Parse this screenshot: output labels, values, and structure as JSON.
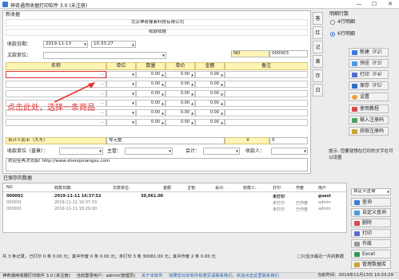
{
  "window": {
    "title": "神奇通用收据打印软件 3.0 (未注册)",
    "minimize": "—",
    "maximize": "☐",
    "close": "✕"
  },
  "form": {
    "section_title": "新收据",
    "company": "北京神奇像素科技有限公司",
    "receipt_title": "收款收据",
    "date_label": "收款日期：",
    "date_value": "2019-11-13",
    "time_value": "10:33:27",
    "unit_label": "文款单位：",
    "no_label": "NO",
    "no_value": "000003",
    "columns": [
      "名称",
      "单位",
      "数量",
      "单价",
      "金额",
      "备注"
    ],
    "rows": [
      {
        "name": "...",
        "qty": "0.00",
        "price": "0.00",
        "amount": "0.00"
      },
      {
        "name": "...",
        "qty": "0.00",
        "price": "0.00",
        "amount": "0.00"
      },
      {
        "name": "...",
        "qty": "0.00",
        "price": "0.00",
        "amount": "0.00"
      },
      {
        "name": "...",
        "qty": "0.00",
        "price": "0.00",
        "amount": "0.00"
      },
      {
        "name": "...",
        "qty": "0.00",
        "price": "0.00",
        "amount": "0.00"
      },
      {
        "name": "...",
        "qty": "0.00",
        "price": "0.00",
        "amount": "0.00"
      }
    ],
    "annotation": "点击此处，选择一条商品",
    "total_cn_label": "合计人民币（大写）",
    "total_cn_value": "零元整",
    "yen": "￥",
    "total_value": "0",
    "seal_label": "收款单位（盖章）：",
    "manager_label": "主管：",
    "accountant_label": "会计：",
    "payee_label": "收款人：",
    "footer_text": "欢迎至再次光临! http://www.shenqixiangsu.com"
  },
  "vtabs": [
    "客户",
    "红",
    "记帐",
    "黄",
    "存根",
    "白"
  ],
  "right": {
    "style_label": "明细行数",
    "option1": "4行明细",
    "option2": "6行明细",
    "buttons": [
      "新建（F2）",
      "预览（F3）",
      "打印（F4）",
      "保存（F5）",
      "设置",
      "使用教程",
      "输入注册码",
      "获取注册码"
    ],
    "tip": "提示: 您要就想在打印的文字在可以设置"
  },
  "list": {
    "title": "已保存的数据",
    "headers": [
      "NO",
      "收款日期:",
      "文款单位:",
      "金额",
      "主管:",
      "会计:",
      "收款人:",
      "打印",
      "作废",
      "用户"
    ],
    "rows": [
      {
        "no": "000002",
        "date": "2019-11-11 16:37:52",
        "amount": "30,061.00",
        "print": "未打印",
        "void": "",
        "user": "guest",
        "bold": true
      },
      {
        "no": "000001",
        "date": "2019-11-11 16:37:33",
        "amount": "",
        "print": "未打印",
        "void": "已作废",
        "user": "admin",
        "bold": false
      },
      {
        "no": "000001",
        "date": "2019-11-11 18:29:00",
        "amount": "",
        "print": "未打印",
        "void": "已作废",
        "user": "admin",
        "bold": false
      }
    ]
  },
  "list_right": {
    "query_label": "自定义查询",
    "buttons": [
      "查询",
      "自定义查询",
      "删除",
      "打印",
      "作废",
      "Excel",
      "管理数据库"
    ]
  },
  "status1": "共 3 条记录，已打印 0 条 0.00 元；其中作废 0 条 0.00 元；未打印 3 条 30061.00 元；其中作废 2 条 0.00 元",
  "status2": "□只显示最近一月的数据",
  "footer": {
    "app": "神奇通用收据打印软件 3.0 (未注册)",
    "user": "当前登录用户：admin(管理员)",
    "about": "关于本软件",
    "reg": "如果您对本软件有意见请联系我们，欢迎点击这里联系我们",
    "time": "当前时间：2019年11月13日 10:33:29"
  }
}
